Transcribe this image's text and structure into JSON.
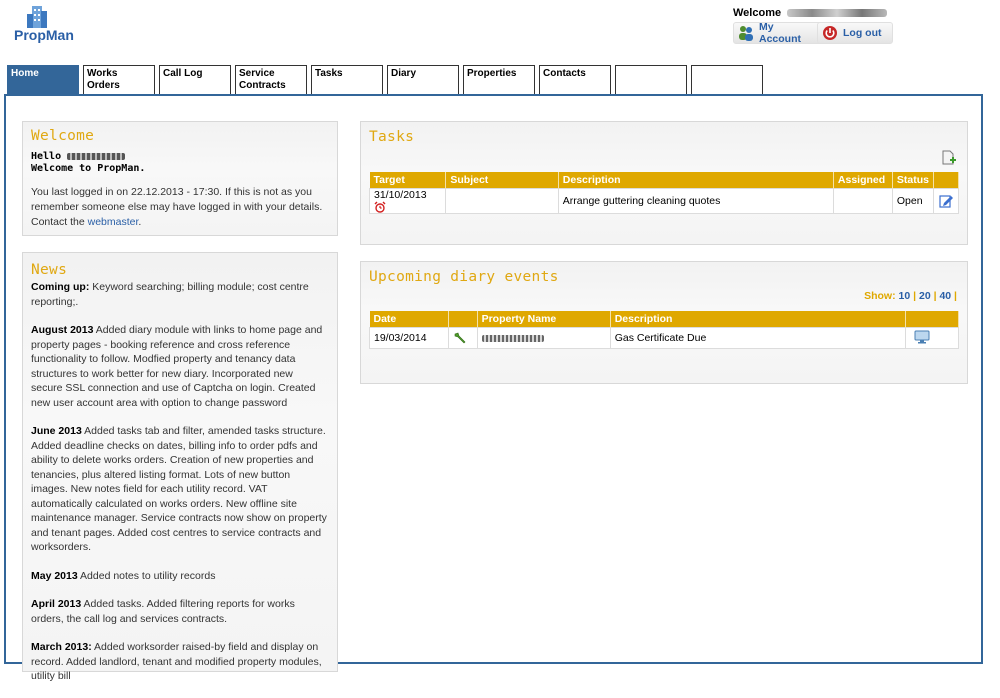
{
  "app": {
    "logo_text": "PropMan"
  },
  "header": {
    "welcome_label": "Welcome",
    "my_account": "My Account",
    "log_out": "Log out"
  },
  "tabs": [
    {
      "label": "Home",
      "active": true
    },
    {
      "label": "Works Orders"
    },
    {
      "label": "Call Log"
    },
    {
      "label": "Service Contracts"
    },
    {
      "label": "Tasks"
    },
    {
      "label": "Diary"
    },
    {
      "label": "Properties"
    },
    {
      "label": "Contacts"
    },
    {
      "label": ""
    },
    {
      "label": ""
    }
  ],
  "welcome": {
    "title": "Welcome",
    "hello_prefix": "Hello",
    "welcome_line": "Welcome to PropMan.",
    "login_note": "You last logged in on 22.12.2013 - 17:30. If this is not as you remember someone else may have logged in with your details. Contact the",
    "login_link": "webmaster",
    "login_tail": "."
  },
  "news": {
    "title": "News",
    "entries": [
      {
        "heading": "Coming up:",
        "text": " Keyword searching; billing module; cost centre reporting;."
      },
      {
        "heading": "August 2013",
        "text": " Added diary module with links to home page and property pages - booking reference and cross reference functionality to follow. Modfied property and tenancy data structures to work better for new diary. Incorporated new secure SSL connection and use of Captcha on login. Created new user account area with option to change password"
      },
      {
        "heading": "June 2013",
        "text": " Added tasks tab and filter, amended tasks structure. Added deadline checks on dates, billing info to order pdfs and ability to delete works orders. Creation of new properties and tenancies, plus altered listing format. Lots of new button images. New notes field for each utility record. VAT automatically calculated on works orders. New offline site maintenance manager. Service contracts now show on property and tenant pages. Added cost centres to service contracts and worksorders."
      },
      {
        "heading": "May 2013",
        "text": " Added notes to utility records"
      },
      {
        "heading": "April 2013",
        "text": " Added tasks. Added filtering reports for works orders, the call log and services contracts."
      },
      {
        "heading": "March 2013:",
        "text": " Added worksorder raised-by field and display on record. Added landlord, tenant and modified property modules, utility bill"
      }
    ]
  },
  "tasks": {
    "title": "Tasks",
    "columns": [
      "Target",
      "Subject",
      "Description",
      "Assigned",
      "Status",
      ""
    ],
    "rows": [
      {
        "target": "31/10/2013",
        "subject": "",
        "description": "Arrange guttering cleaning quotes",
        "assigned": "",
        "status": "Open"
      }
    ]
  },
  "diary": {
    "title": "Upcoming diary events",
    "show_label": "Show:",
    "show_options": [
      "10",
      "20",
      "40"
    ],
    "columns": [
      "Date",
      "",
      "Property Name",
      "Description",
      ""
    ],
    "rows": [
      {
        "date": "19/03/2014",
        "description": "Gas Certificate Due"
      }
    ]
  },
  "colors": {
    "accent": "#dfa800",
    "brand": "#336699",
    "link": "#2a5fa6",
    "title": "#e0a812"
  },
  "icons": [
    "building-logo-icon",
    "users-icon",
    "power-icon",
    "add-task-icon",
    "alarm-clock-icon",
    "edit-icon",
    "wrench-icon",
    "monitor-icon"
  ]
}
